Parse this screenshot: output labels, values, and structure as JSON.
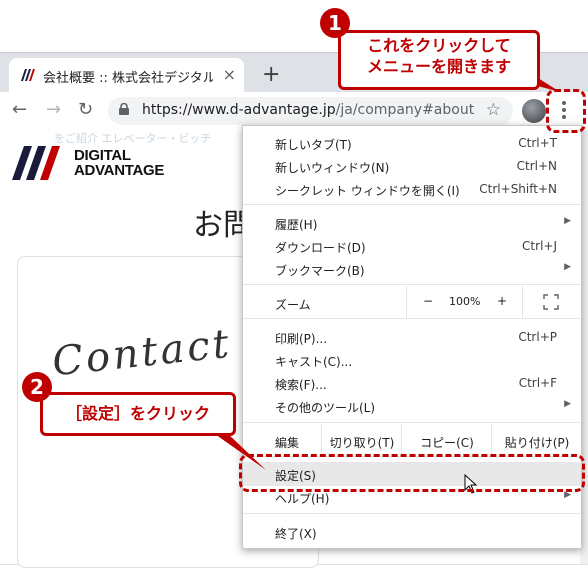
{
  "browser": {
    "tab_title": "会社概要 :: 株式会社デジタルアドバ",
    "tab_close": "×",
    "new_tab": "+",
    "url_host": "https://www.d-advantage.jp",
    "url_path": "/ja/company#about",
    "back": "←",
    "forward": "→",
    "reload": "↻",
    "star": "☆"
  },
  "page": {
    "logo_line1": "DIGITAL",
    "logo_line2": "ADVANTAGE",
    "faint": "をご紹介 エレベーター・ビッチ",
    "heading": "お問",
    "script_text": "Contact"
  },
  "menu": {
    "items": [
      {
        "label": "新しいタブ(T)",
        "shortcut": "Ctrl+T"
      },
      {
        "label": "新しいウィンドウ(N)",
        "shortcut": "Ctrl+N"
      },
      {
        "label": "シークレット ウィンドウを開く(I)",
        "shortcut": "Ctrl+Shift+N"
      },
      {
        "label": "履歴(H)",
        "shortcut": ""
      },
      {
        "label": "ダウンロード(D)",
        "shortcut": "Ctrl+J"
      },
      {
        "label": "ブックマーク(B)",
        "shortcut": ""
      },
      {
        "label": "印刷(P)...",
        "shortcut": "Ctrl+P"
      },
      {
        "label": "キャスト(C)...",
        "shortcut": ""
      },
      {
        "label": "検索(F)...",
        "shortcut": "Ctrl+F"
      },
      {
        "label": "その他のツール(L)",
        "shortcut": ""
      },
      {
        "label": "設定(S)",
        "shortcut": ""
      },
      {
        "label": "ヘルプ(H)",
        "shortcut": ""
      },
      {
        "label": "終了(X)",
        "shortcut": ""
      }
    ],
    "zoom": {
      "label": "ズーム",
      "minus": "−",
      "value": "100%",
      "plus": "+"
    },
    "edit": {
      "label": "編集",
      "cut": "切り取り(T)",
      "copy": "コピー(C)",
      "paste": "貼り付け(P)"
    }
  },
  "callouts": {
    "one": {
      "num": "1",
      "line1": "これをクリックして",
      "line2": "メニューを開きます"
    },
    "two": {
      "num": "2",
      "text": "［設定］をクリック"
    }
  },
  "colors": {
    "accent": "#c00000"
  }
}
